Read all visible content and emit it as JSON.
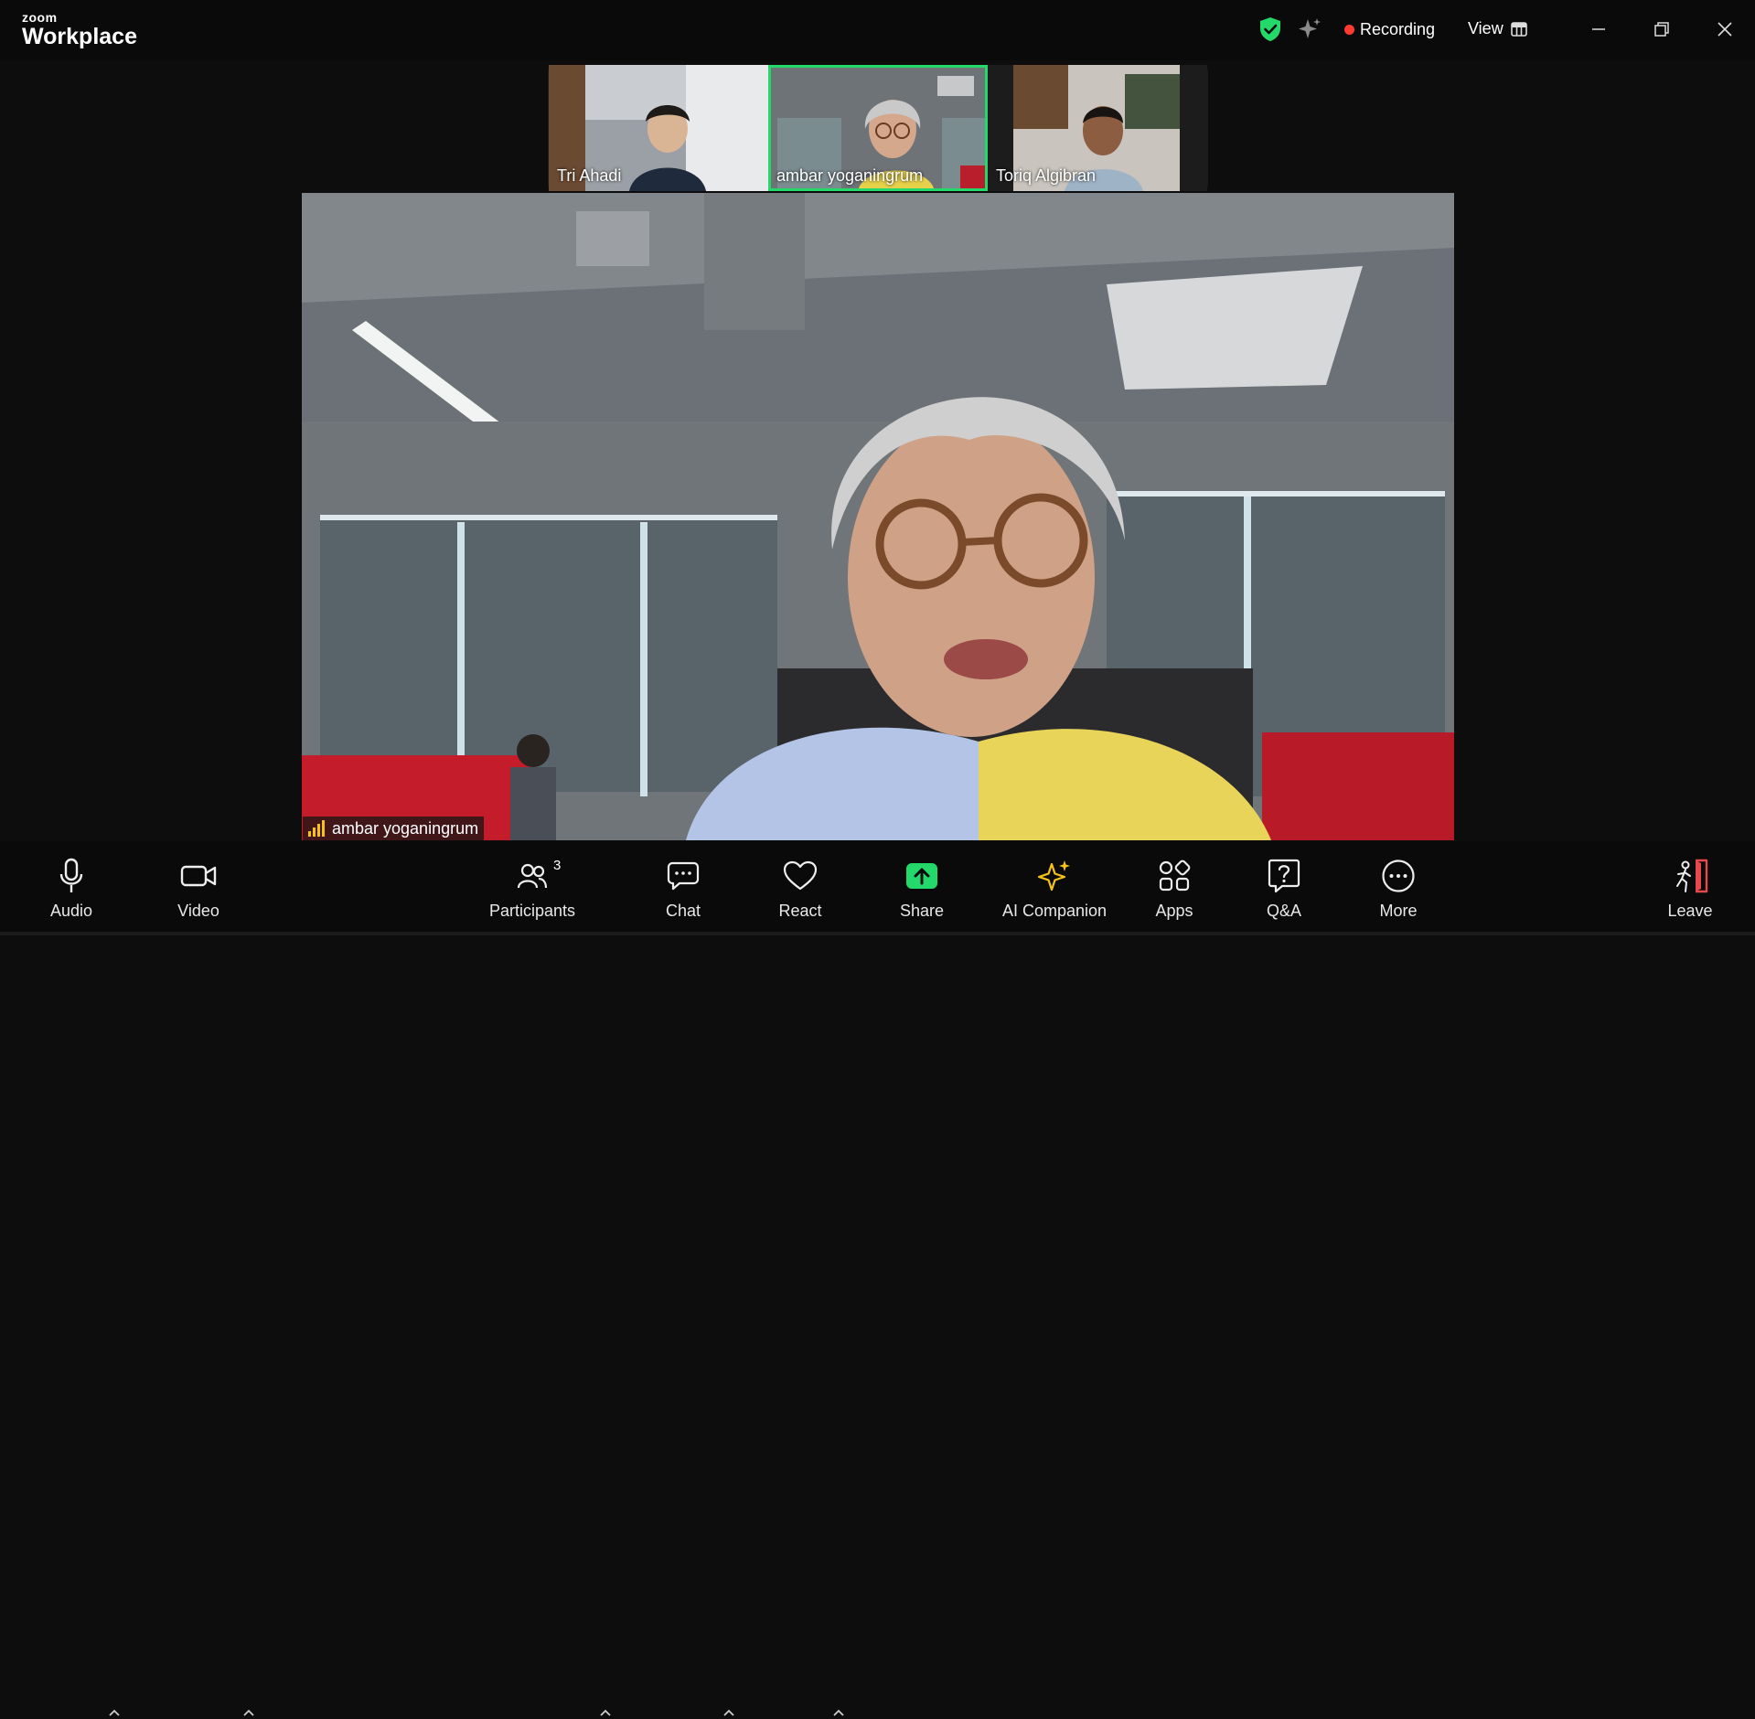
{
  "app": {
    "brand_small": "zoom",
    "brand_large": "Workplace"
  },
  "header": {
    "recording_label": "Recording",
    "view_label": "View"
  },
  "participants_strip": [
    {
      "name": "Tri Ahadi",
      "active": false
    },
    {
      "name": "ambar yoganingrum",
      "active": true
    },
    {
      "name": "Toriq Algibran",
      "active": false
    }
  ],
  "main_video": {
    "speaker_name": "ambar yoganingrum"
  },
  "toolbar": {
    "audio": "Audio",
    "video": "Video",
    "participants": "Participants",
    "participants_count": "3",
    "chat": "Chat",
    "react": "React",
    "share": "Share",
    "ai_companion": "AI Companion",
    "apps": "Apps",
    "qa": "Q&A",
    "more": "More",
    "leave": "Leave"
  },
  "colors": {
    "accent_green": "#23d96a",
    "record_red": "#ff3b30",
    "ai_gold": "#f6c21a",
    "leave_red": "#e5484d"
  }
}
